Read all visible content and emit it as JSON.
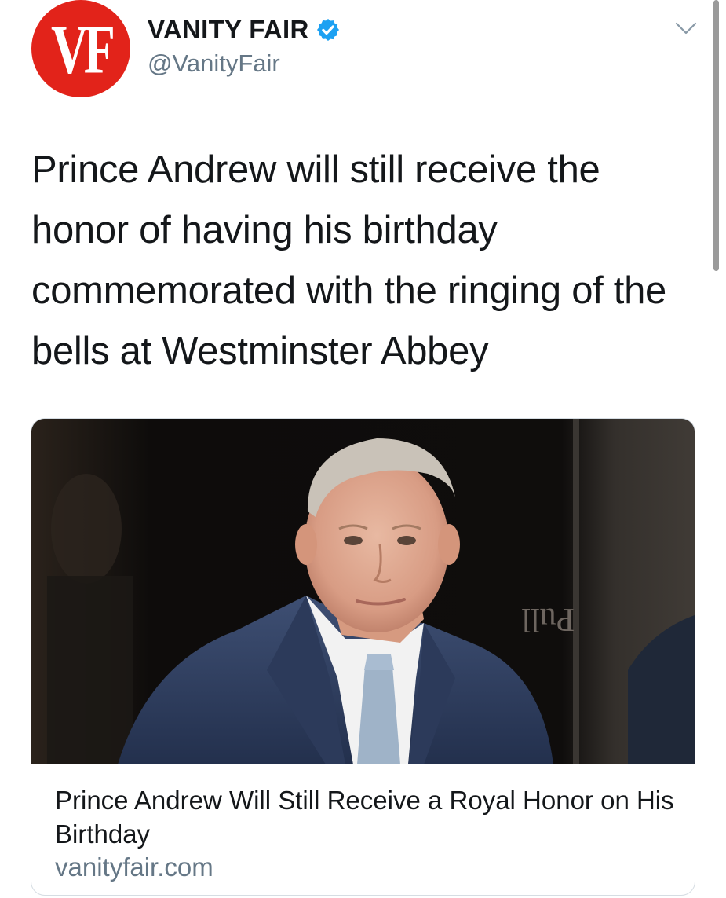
{
  "author": {
    "avatar_text": "VF",
    "name": "VANITY FAIR",
    "handle": "@VanityFair",
    "verified": true,
    "avatar_color": "#e2231a",
    "verified_color": "#1da1f2"
  },
  "menu": {
    "icon": "chevron-down-icon"
  },
  "tweet": {
    "text": "Prince Andrew will still receive the honor of having his birthday commemorated with the ringing of the bells at Westminster Abbey"
  },
  "card": {
    "image_sign_text": "Pull",
    "title": "Prince Andrew Will Still Receive a Royal Honor on His Birthday",
    "domain": "vanityfair.com"
  },
  "colors": {
    "text_primary": "#14171a",
    "text_secondary": "#657786",
    "card_border": "#d6dde3"
  }
}
